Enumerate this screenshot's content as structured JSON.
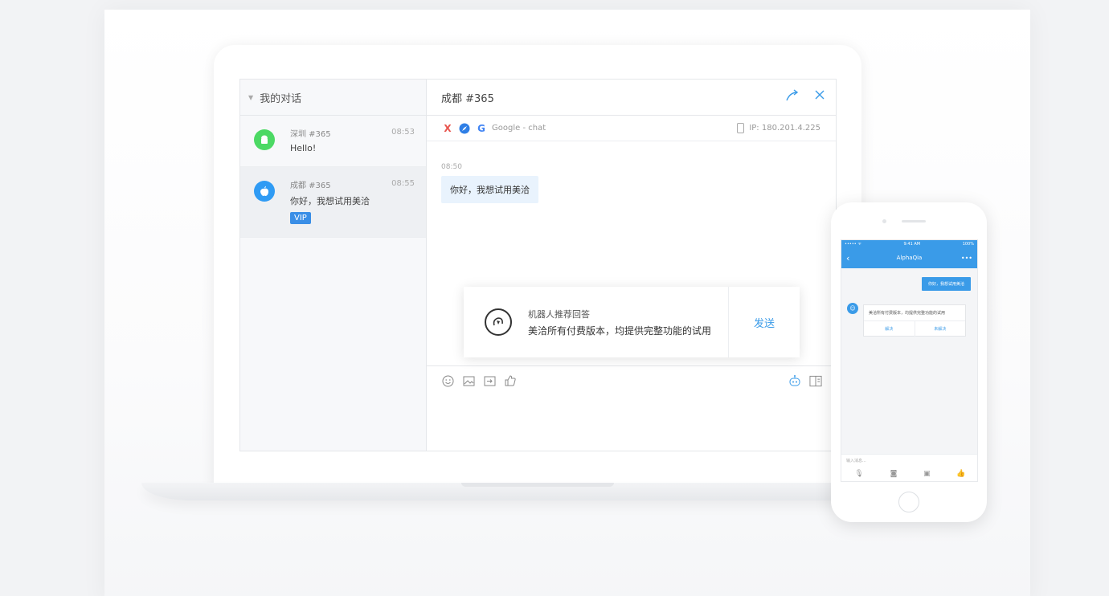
{
  "left_panel": {
    "title": "我的对话",
    "conversations": [
      {
        "name": "深圳 #365",
        "time": "08:53",
        "message": "Hello!",
        "platform": "android",
        "color": "#4cd964"
      },
      {
        "name": "成都 #365",
        "time": "08:55",
        "message": "你好，我想试用美洽",
        "platform": "apple",
        "color": "#2f9bf4",
        "badge": "VIP"
      }
    ]
  },
  "chat": {
    "title": "成都 #365",
    "source": "Google - chat",
    "ip": "IP: 180.201.4.225",
    "messages": [
      {
        "time": "08:50",
        "text": "你好，我想试用美洽"
      }
    ]
  },
  "robot": {
    "title": "机器人推荐回答",
    "text": "美洽所有付费版本，均提供完整功能的试用",
    "send_label": "发送"
  },
  "phone": {
    "status_left": "••••• ᯤ",
    "status_time": "9:41 AM",
    "status_right": "100%",
    "title": "AlphaQia",
    "user_message": "你好，我想试用美洽",
    "bot_message": "美洽所有付费版本，均提供完整功能的试用",
    "action_resolved": "解决",
    "action_unresolved": "未解决",
    "input_placeholder": "输入消息..."
  },
  "colors": {
    "accent": "#3a9be8",
    "vip": "#3a8ee6",
    "android": "#4cd964",
    "apple": "#2f9bf4"
  }
}
